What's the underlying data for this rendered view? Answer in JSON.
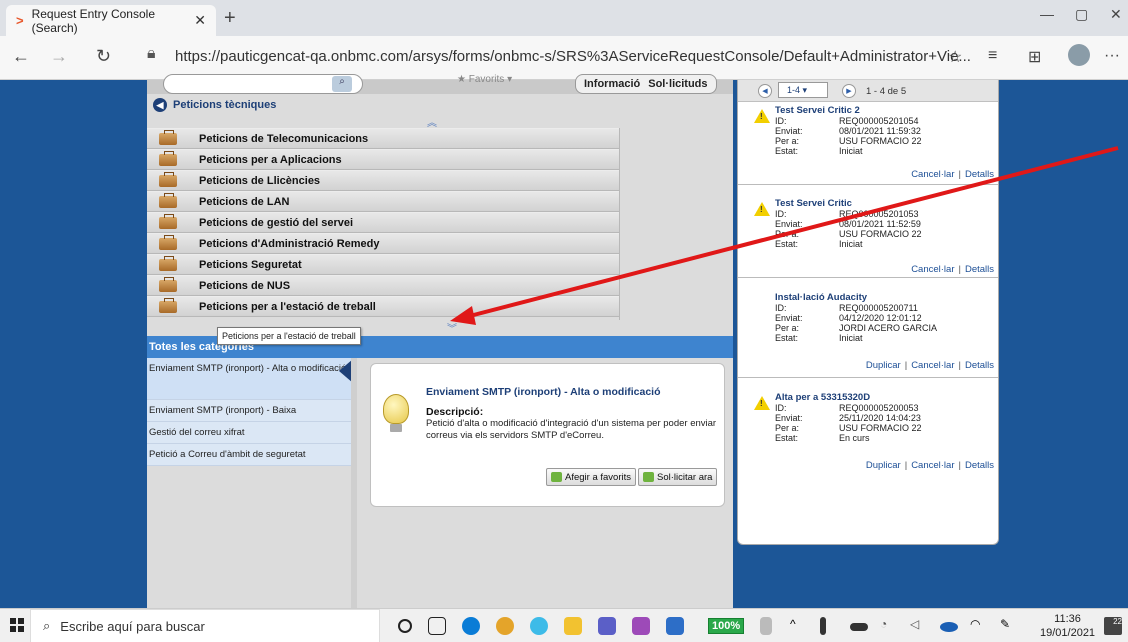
{
  "browser": {
    "tab_title": "Request Entry Console (Search)",
    "tab_close": "✕",
    "new_tab": "+",
    "url": "https://pauticgencat-qa.onbmc.com/arsys/forms/onbmc-s/SRS%3AServiceRequestConsole/Default+Administrator+Vie...",
    "win_min": "—",
    "win_max": "▢",
    "win_close": "✕",
    "more": "···"
  },
  "console": {
    "favorites_label": "Favorits",
    "info_tab": "Informació",
    "requests_tab": "Sol·licituds",
    "section_title": "Peticions tècniques",
    "categories": [
      "Peticions de Telecomunicacions",
      "Peticions per a Aplicacions",
      "Peticions de Llicències",
      "Peticions de LAN",
      "Peticions de gestió del servei",
      "Peticions d'Administració Remedy",
      "Peticions Seguretat",
      "Peticions de NUS",
      "Peticions per a l'estació de treball"
    ],
    "tooltip": "Peticions per a l'estació de treball",
    "all_categories": "Totes les categories",
    "sub_items": [
      "Enviament SMTP (ironport) - Alta o modificació",
      "Enviament SMTP (ironport) - Baixa",
      "Gestió del correu xifrat",
      "Petició a Correu d'àmbit de seguretat"
    ],
    "detail": {
      "title": "Enviament SMTP (ironport) - Alta o modificació",
      "desc_label": "Descripció:",
      "desc_text": "Petició d'alta o modificació d'integració d'un sistema per poder enviar correus via els servidors SMTP d'eCorreu.",
      "add_fav": "Afegir a favorits",
      "request_now": "Sol·licitar ara"
    }
  },
  "requests_panel": {
    "pager_range": "1-4",
    "pager_count": "1 - 4 de 5",
    "labels": {
      "id": "ID:",
      "sent": "Enviat:",
      "for": "Per a:",
      "state": "Estat:"
    },
    "cancel": "Cancel·lar",
    "details": "Detalls",
    "duplicate": "Duplicar",
    "items": [
      {
        "title": "Test Servei Critic 2",
        "id": "REQ000005201054",
        "sent": "08/01/2021 11:59:32",
        "for": "USU FORMACIO 22",
        "state": "Iniciat"
      },
      {
        "title": "Test Servei Critic",
        "id": "REQ000005201053",
        "sent": "08/01/2021 11:52:59",
        "for": "USU FORMACIO 22",
        "state": "Iniciat"
      },
      {
        "title": "Instal·lació Audacity",
        "id": "REQ000005200711",
        "sent": "04/12/2020 12:01:12",
        "for": "JORDI ACERO GARCIA",
        "state": "Iniciat"
      },
      {
        "title": "Alta per a 53315320D",
        "id": "REQ000005200053",
        "sent": "25/11/2020 14:04:23",
        "for": "USU FORMACIO 22",
        "state": "En curs"
      }
    ]
  },
  "taskbar": {
    "search_placeholder": "Escribe aquí para buscar",
    "zoom": "100%",
    "time": "11:36",
    "date": "19/01/2021",
    "notifications": "22"
  },
  "colors": {
    "background": "#1c5697",
    "arrow": "#e01818",
    "accent": "#3e84cf"
  }
}
